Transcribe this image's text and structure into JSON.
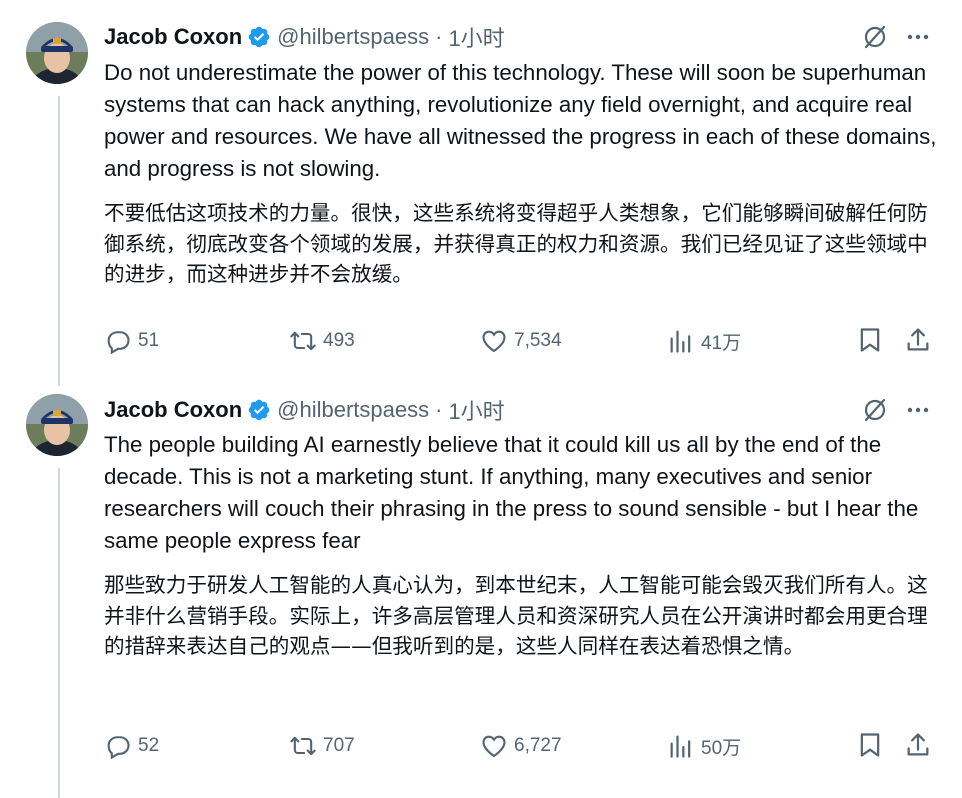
{
  "tweets": [
    {
      "author": {
        "name": "Jacob Coxon",
        "handle": "@hilbertspaess",
        "time": "1小时",
        "dot": "·"
      },
      "text_en": "Do not underestimate the power of this technology. These will soon be superhuman systems that can hack anything, revolutionize any field overnight, and acquire real power and resources. We have all witnessed the progress in each of these domains, and progress is not slowing.",
      "text_zh": "不要低估这项技术的力量。很快，这些系统将变得超乎人类想象，它们能够瞬间破解任何防御系统，彻底改变各个领域的发展，并获得真正的权力和资源。我们已经见证了这些领域中的进步，而这种进步并不会放缓。",
      "stats": {
        "replies": "51",
        "retweets": "493",
        "likes": "7,534",
        "views": "41万"
      }
    },
    {
      "author": {
        "name": "Jacob Coxon",
        "handle": "@hilbertspaess",
        "time": "1小时",
        "dot": "·"
      },
      "text_en": "The people building AI earnestly believe that it could kill us all by the end of the decade. This is not a marketing stunt. If anything, many executives and senior researchers will couch their phrasing in the press to sound sensible - but I hear the same people express fear",
      "text_zh": "那些致力于研发人工智能的人真心认为，到本世纪末，人工智能可能会毁灭我们所有人。这并非什么营销手段。实际上，许多高层管理人员和资深研究人员在公开演讲时都会用更合理的措辞来表达自己的观点——但我听到的是，这些人同样在表达着恐惧之情。",
      "stats": {
        "replies": "52",
        "retweets": "707",
        "likes": "6,727",
        "views": "50万"
      }
    }
  ],
  "icons": {
    "verified": "verified-badge-icon",
    "grok": "grok-icon",
    "more": "more-icon",
    "reply": "reply-icon",
    "retweet": "retweet-icon",
    "like": "heart-icon",
    "views": "views-icon",
    "bookmark": "bookmark-icon",
    "share": "share-icon"
  },
  "colors": {
    "text": "#0f1419",
    "secondary": "#536471",
    "verified": "#1d9bf0",
    "thread_line": "#cfd9de"
  }
}
